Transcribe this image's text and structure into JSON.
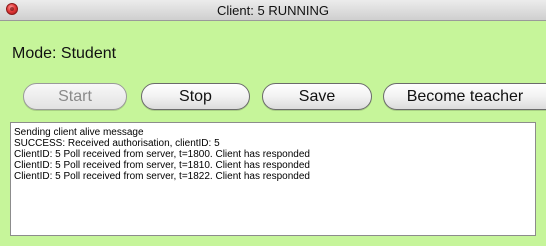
{
  "window": {
    "title": "Client: 5 RUNNING"
  },
  "mode_label": "Mode: Student",
  "buttons": {
    "start": "Start",
    "stop": "Stop",
    "save": "Save",
    "become_teacher": "Become teacher"
  },
  "log": [
    "Sending client alive message",
    "SUCCESS: Received authorisation, clientID: 5",
    "ClientID: 5 Poll received from server, t=1800. Client has responded",
    "ClientID: 5 Poll received from server, t=1810. Client has responded",
    "ClientID: 5 Poll received from server, t=1822. Client has responded"
  ],
  "colors": {
    "background": "#c6f59a",
    "close_button": "#e23a3a"
  }
}
